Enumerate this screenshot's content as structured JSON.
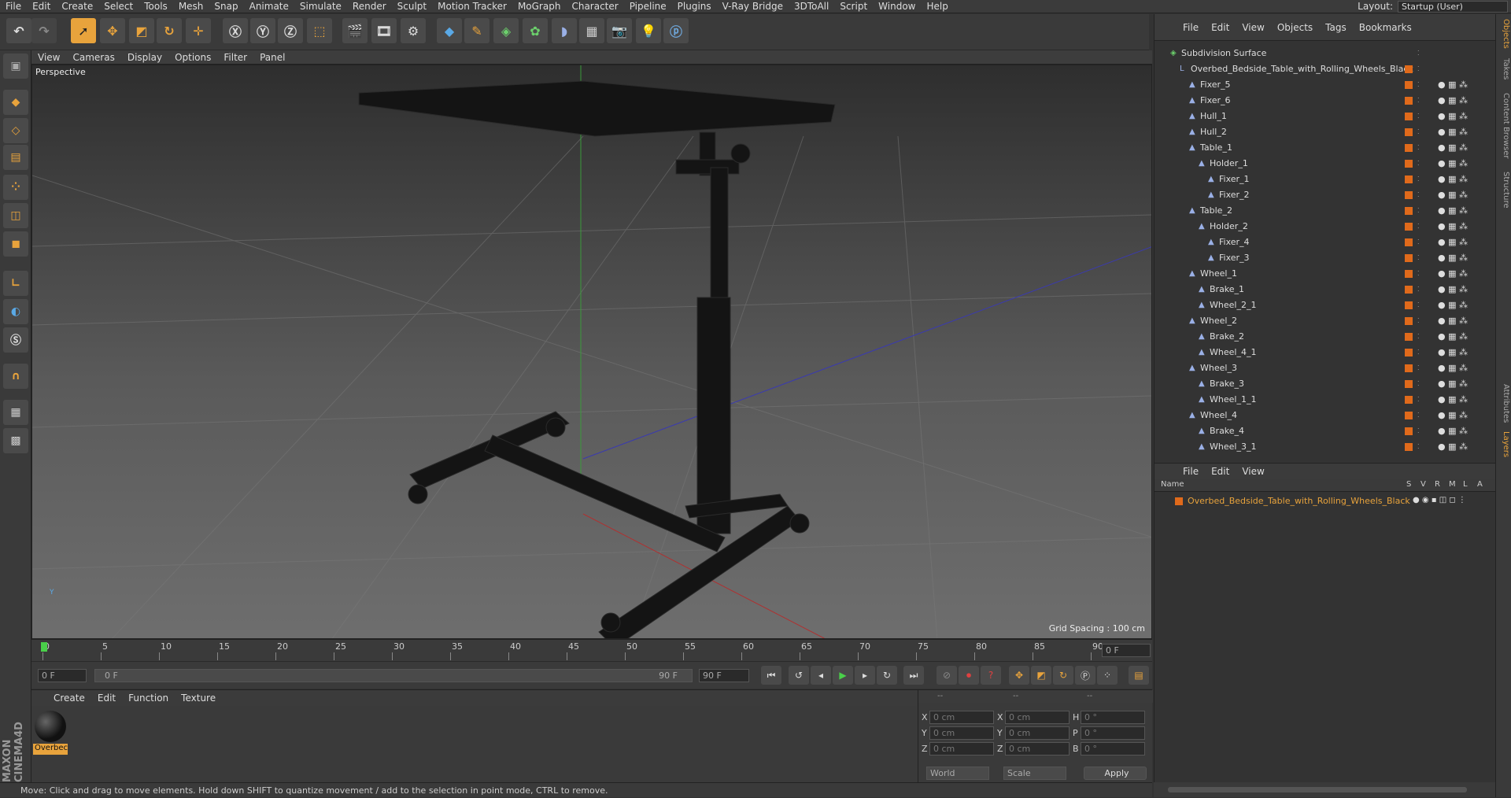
{
  "menubar": {
    "items": [
      "File",
      "Edit",
      "Create",
      "Select",
      "Tools",
      "Mesh",
      "Snap",
      "Animate",
      "Simulate",
      "Render",
      "Sculpt",
      "Motion Tracker",
      "MoGraph",
      "Character",
      "Pipeline",
      "Plugins",
      "V-Ray Bridge",
      "3DToAll",
      "Script",
      "Window",
      "Help"
    ],
    "layout_label": "Layout:",
    "layout_value": "Startup (User)"
  },
  "viewport": {
    "menus": [
      "View",
      "Cameras",
      "Display",
      "Options",
      "Filter",
      "Panel"
    ],
    "label": "Perspective",
    "grid_spacing": "Grid Spacing : 100 cm",
    "axes": {
      "y": "Y",
      "x": "X",
      "z": "Z"
    }
  },
  "timeline": {
    "ticks": [
      "0",
      "5",
      "10",
      "15",
      "20",
      "25",
      "30",
      "35",
      "40",
      "45",
      "50",
      "55",
      "60",
      "65",
      "70",
      "75",
      "80",
      "85",
      "90"
    ],
    "current_frame": "0 F"
  },
  "transport": {
    "start_field": "0 F",
    "range_start": "0 F",
    "range_end": "90 F",
    "end_field": "90 F"
  },
  "material_panel": {
    "menus": [
      "Create",
      "Edit",
      "Function",
      "Texture"
    ],
    "material_name": "Overbec"
  },
  "coord_panel": {
    "headers": [
      "--",
      "--",
      "--"
    ],
    "rows": [
      {
        "a": "X",
        "av": "0 cm",
        "b": "X",
        "bv": "0 cm",
        "c": "H",
        "cv": "0 °"
      },
      {
        "a": "Y",
        "av": "0 cm",
        "b": "Y",
        "bv": "0 cm",
        "c": "P",
        "cv": "0 °"
      },
      {
        "a": "Z",
        "av": "0 cm",
        "b": "Z",
        "bv": "0 cm",
        "c": "B",
        "cv": "0 °"
      }
    ],
    "world": "World",
    "scale": "Scale",
    "apply": "Apply"
  },
  "statusbar": {
    "text": "Move: Click and drag to move elements. Hold down SHIFT to quantize movement / add to the selection in point mode, CTRL to remove."
  },
  "object_manager": {
    "menus": [
      "File",
      "Edit",
      "View",
      "Objects",
      "Tags",
      "Bookmarks"
    ],
    "objects": [
      {
        "name": "Subdivision Surface",
        "level": 0
      },
      {
        "name": "Overbed_Bedside_Table_with_Rolling_Wheels_Black",
        "level": 1
      },
      {
        "name": "Fixer_5",
        "level": 2
      },
      {
        "name": "Fixer_6",
        "level": 2
      },
      {
        "name": "Hull_1",
        "level": 2
      },
      {
        "name": "Hull_2",
        "level": 2
      },
      {
        "name": "Table_1",
        "level": 2
      },
      {
        "name": "Holder_1",
        "level": 3
      },
      {
        "name": "Fixer_1",
        "level": 4
      },
      {
        "name": "Fixer_2",
        "level": 4
      },
      {
        "name": "Table_2",
        "level": 2
      },
      {
        "name": "Holder_2",
        "level": 3
      },
      {
        "name": "Fixer_4",
        "level": 4
      },
      {
        "name": "Fixer_3",
        "level": 4
      },
      {
        "name": "Wheel_1",
        "level": 2
      },
      {
        "name": "Brake_1",
        "level": 3
      },
      {
        "name": "Wheel_2_1",
        "level": 3
      },
      {
        "name": "Wheel_2",
        "level": 2
      },
      {
        "name": "Brake_2",
        "level": 3
      },
      {
        "name": "Wheel_4_1",
        "level": 3
      },
      {
        "name": "Wheel_3",
        "level": 2
      },
      {
        "name": "Brake_3",
        "level": 3
      },
      {
        "name": "Wheel_1_1",
        "level": 3
      },
      {
        "name": "Wheel_4",
        "level": 2
      },
      {
        "name": "Brake_4",
        "level": 3
      },
      {
        "name": "Wheel_3_1",
        "level": 3
      }
    ]
  },
  "layer_manager": {
    "menus": [
      "File",
      "Edit",
      "View"
    ],
    "columns": [
      "Name",
      "S",
      "V",
      "R",
      "M",
      "L",
      "A"
    ],
    "layer_name": "Overbed_Bedside_Table_with_Rolling_Wheels_Black"
  },
  "side_tabs": [
    "Objects",
    "Takes",
    "Content Browser",
    "Structure",
    "Attributes",
    "Layers"
  ],
  "colors": {
    "accent": "#e8a33c",
    "orange_tag": "#e06a1b",
    "selected": "#e06a1b"
  }
}
